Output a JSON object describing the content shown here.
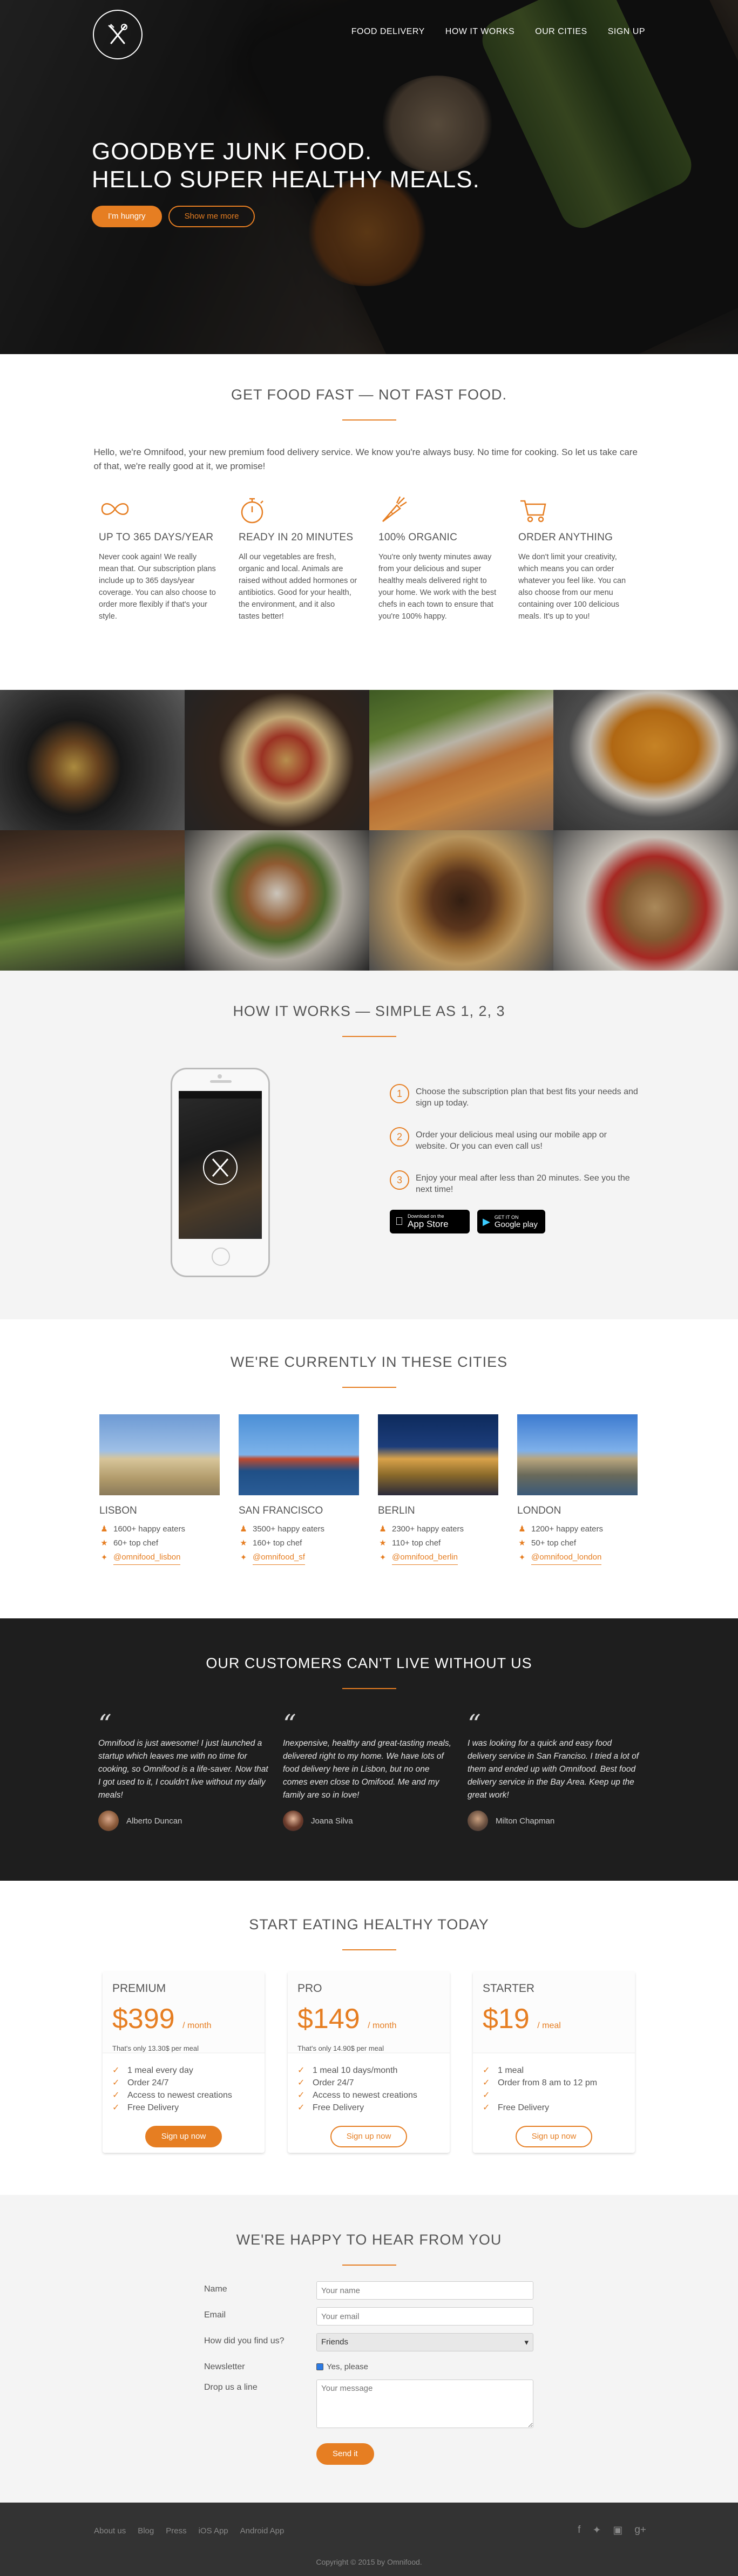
{
  "nav": {
    "items": [
      "Food delivery",
      "How it works",
      "Our cities",
      "Sign up"
    ]
  },
  "hero": {
    "title_line1": "Goodbye junk food.",
    "title_line2": "Hello super healthy meals.",
    "primary_button": "I'm hungry",
    "secondary_button": "Show me more"
  },
  "features": {
    "title": "Get food fast — not fast food.",
    "intro": "Hello, we're Omnifood, your new premium food delivery service. We know you're always busy. No time for cooking. So let us take care of that, we're really good at it, we promise!",
    "items": [
      {
        "icon": "infinity-icon",
        "title": "Up to 365 days/year",
        "text": "Never cook again! We really mean that. Our subscription plans include up to 365 days/year coverage. You can also choose to order more flexibly if that's your style."
      },
      {
        "icon": "stopwatch-icon",
        "title": "Ready in 20 minutes",
        "text": "All our vegetables are fresh, organic and local. Animals are raised without added hormones or antibiotics. Good for your health, the environment, and it also tastes better!"
      },
      {
        "icon": "carrot-icon",
        "title": "100% organic",
        "text": "You're only twenty minutes away from your delicious and super healthy meals delivered right to your home. We work with the best chefs in each town to ensure that you're 100% happy."
      },
      {
        "icon": "cart-icon",
        "title": "Order anything",
        "text": "We don't limit your creativity, which means you can order whatever you feel like. You can also choose from our menu containing over 100 delicious meals. It's up to you!"
      }
    ]
  },
  "how": {
    "title": "How it works — Simple as 1, 2, 3",
    "steps": [
      {
        "num": "1",
        "text": "Choose the subscription plan that best fits your needs and sign up today."
      },
      {
        "num": "2",
        "text": "Order your delicious meal using our mobile app or website. Or you can even call us!"
      },
      {
        "num": "3",
        "text": "Enjoy your meal after less than 20 minutes. See you the next time!"
      }
    ],
    "appstore": {
      "small": "Download on the",
      "big": "App Store"
    },
    "googleplay": {
      "small": "GET IT ON",
      "big": "Google play"
    }
  },
  "cities": {
    "title": "We're currently in these cities",
    "items": [
      {
        "name": "Lisbon",
        "eaters": "1600+ happy eaters",
        "chefs": "60+ top chef",
        "twitter": "@omnifood_lisbon"
      },
      {
        "name": "San Francisco",
        "eaters": "3500+ happy eaters",
        "chefs": "160+ top chef",
        "twitter": "@omnifood_sf"
      },
      {
        "name": "Berlin",
        "eaters": "2300+ happy eaters",
        "chefs": "110+ top chef",
        "twitter": "@omnifood_berlin"
      },
      {
        "name": "London",
        "eaters": "1200+ happy eaters",
        "chefs": "50+ top chef",
        "twitter": "@omnifood_london"
      }
    ]
  },
  "testimonials": {
    "title": "Our customers can't live without us",
    "items": [
      {
        "quote": "Omnifood is just awesome! I just launched a startup which leaves me with no time for cooking, so Omnifood is a life-saver. Now that I got used to it, I couldn't live without my daily meals!",
        "author": "Alberto Duncan"
      },
      {
        "quote": "Inexpensive, healthy and great-tasting meals, delivered right to my home. We have lots of food delivery here in Lisbon, but no one comes even close to Omifood. Me and my family are so in love!",
        "author": "Joana Silva"
      },
      {
        "quote": "I was looking for a quick and easy food delivery service in San Franciso. I tried a lot of them and ended up with Omnifood. Best food delivery service in the Bay Area. Keep up the great work!",
        "author": "Milton Chapman"
      }
    ]
  },
  "plans": {
    "title": "Start eating healthy today",
    "items": [
      {
        "name": "Premium",
        "price": "$399",
        "unit": "/ month",
        "note": "That's only 13.30$ per meal",
        "features": [
          "1 meal every day",
          "Order 24/7",
          "Access to newest creations",
          "Free Delivery"
        ],
        "button": "Sign up now"
      },
      {
        "name": "Pro",
        "price": "$149",
        "unit": "/ month",
        "note": "That's only 14.90$ per meal",
        "features": [
          "1 meal 10 days/month",
          "Order 24/7",
          "Access to newest creations",
          "Free Delivery"
        ],
        "button": "Sign up now"
      },
      {
        "name": "Starter",
        "price": "$19",
        "unit": "/ meal",
        "note": "",
        "features": [
          "1 meal",
          "Order from 8 am to 12 pm",
          "",
          "Free Delivery"
        ],
        "button": "Sign up now"
      }
    ]
  },
  "form": {
    "title": "We're happy to hear from you",
    "name_label": "Name",
    "name_placeholder": "Your name",
    "email_label": "Email",
    "email_placeholder": "Your email",
    "find_label": "How did you find us?",
    "find_value": "Friends",
    "newsletter_label": "Newsletter",
    "newsletter_text": "Yes, please",
    "message_label": "Drop us a line",
    "message_placeholder": "Your message",
    "send": "Send it"
  },
  "footer": {
    "links": [
      "About us",
      "Blog",
      "Press",
      "iOS App",
      "Android App"
    ],
    "social": [
      "facebook-icon",
      "twitter-icon",
      "instagram-icon",
      "googleplus-icon"
    ],
    "copyright": "Copyright © 2015 by Omnifood."
  }
}
